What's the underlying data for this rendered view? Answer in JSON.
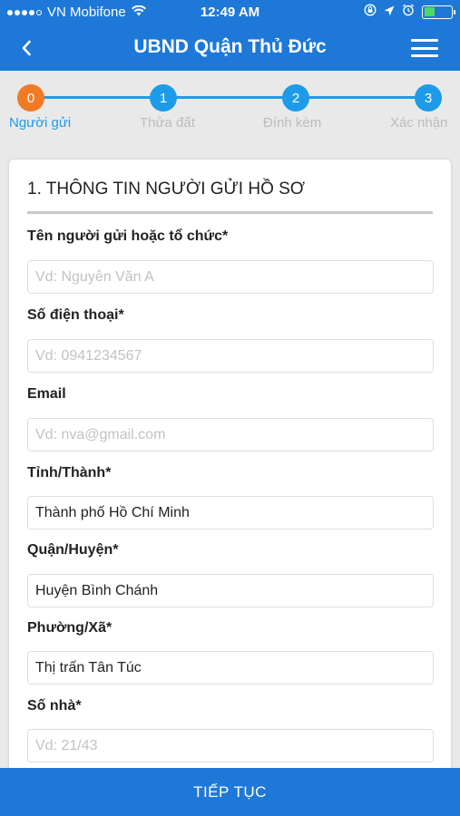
{
  "status_bar": {
    "carrier": "VN Mobifone",
    "time": "12:49 AM",
    "signal_dots_filled": 4,
    "icons": [
      "wifi-icon",
      "screen-lock-icon",
      "location-arrow-icon",
      "alarm-icon",
      "battery-icon"
    ],
    "battery_level": 0.4
  },
  "navbar": {
    "title": "UBND Quận Thủ Đức",
    "back_icon": "chevron-left-icon",
    "menu_icon": "hamburger-menu-icon"
  },
  "steps": [
    {
      "number": "0",
      "label": "Người gửi",
      "active": true
    },
    {
      "number": "1",
      "label": "Thửa đất",
      "active": false
    },
    {
      "number": "2",
      "label": "Đính kèm",
      "active": false
    },
    {
      "number": "3",
      "label": "Xác nhận",
      "active": false
    }
  ],
  "form": {
    "section_title": "1. THÔNG TIN NGƯỜI GỬI HỒ SƠ",
    "fields": [
      {
        "label": "Tên người gửi hoặc tổ chức*",
        "value": "",
        "placeholder": "Vd: Nguyễn Văn A"
      },
      {
        "label": "Số điện thoại*",
        "value": "",
        "placeholder": "Vd: 0941234567"
      },
      {
        "label": "Email",
        "value": "",
        "placeholder": "Vd: nva@gmail.com"
      },
      {
        "label": "Tỉnh/Thành*",
        "value": "Thành phố Hồ Chí Minh",
        "placeholder": ""
      },
      {
        "label": "Quận/Huyện*",
        "value": "Huyện Bình Chánh",
        "placeholder": ""
      },
      {
        "label": "Phường/Xã*",
        "value": "Thị trấn Tân Túc",
        "placeholder": ""
      },
      {
        "label": "Số nhà*",
        "value": "",
        "placeholder": "Vd: 21/43"
      }
    ]
  },
  "footer": {
    "button_label": "TIẾP TỤC"
  },
  "colors": {
    "primary": "#1e78d8",
    "step_blue": "#1e9be8",
    "step_active": "#f17a25",
    "battery_green": "#4cd964"
  }
}
